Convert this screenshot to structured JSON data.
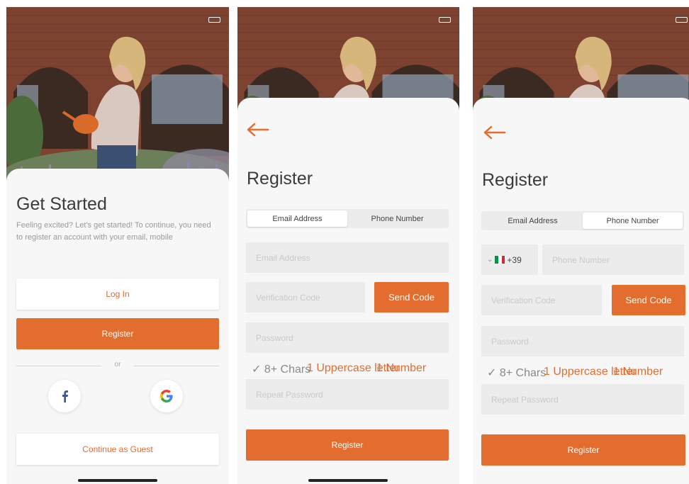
{
  "colors": {
    "accent": "#e36d2e",
    "field_bg": "#ececec",
    "sheet_bg": "#f7f7f7"
  },
  "screen1": {
    "title": "Get Started",
    "description": "Feeling excited? Let's get started! To continue, you need to register an account with your email, mobile",
    "login_label": "Log In",
    "register_label": "Register",
    "or_label": "or",
    "social": [
      {
        "icon": "facebook-icon"
      },
      {
        "icon": "google-icon"
      }
    ],
    "guest_label": "Continue as Guest"
  },
  "screen2": {
    "title": "Register",
    "tabs": [
      {
        "label": "Email Address",
        "active": true
      },
      {
        "label": "Phone Number",
        "active": false
      }
    ],
    "email_placeholder": "Email Address",
    "code_placeholder": "Verification Code",
    "send_code_label": "Send Code",
    "password_placeholder": "Password",
    "hints": [
      {
        "label": "✓ 8+ Chars",
        "state": "ok"
      },
      {
        "label": "1 Uppercase letter",
        "state": "todo"
      },
      {
        "label": "1 Number",
        "state": "todo"
      }
    ],
    "repeat_placeholder": "Repeat Password",
    "register_label": "Register"
  },
  "screen3": {
    "title": "Register",
    "tabs": [
      {
        "label": "Email Address",
        "active": false
      },
      {
        "label": "Phone Number",
        "active": true
      }
    ],
    "country_code": "+39",
    "phone_placeholder": "Phone Number",
    "code_placeholder": "Verification Code",
    "send_code_label": "Send Code",
    "password_placeholder": "Password",
    "hints": [
      {
        "label": "✓ 8+ Chars",
        "state": "ok"
      },
      {
        "label": "1 Uppercase letter",
        "state": "todo"
      },
      {
        "label": "1 Number",
        "state": "todo"
      }
    ],
    "repeat_placeholder": "Repeat Password",
    "register_label": "Register"
  }
}
